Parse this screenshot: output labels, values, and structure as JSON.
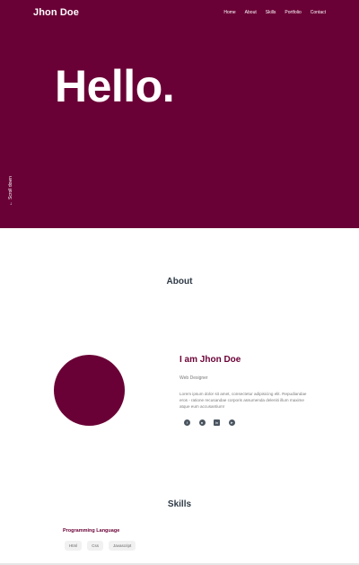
{
  "header": {
    "logo": "Jhon Doe",
    "nav": [
      "Home",
      "About",
      "Skills",
      "Portfolio",
      "Contact"
    ]
  },
  "hero": {
    "greeting": "Hello.",
    "scroll_label": "Scroll down"
  },
  "about": {
    "title": "About",
    "name_heading": "I am Jhon Doe",
    "role": "Web Designer",
    "bio": "Lorem ipsum dolor sit amet, consectetur adipisicing elit. Repudiandae eros - ratione recusandae corporis assumenda deleniti illum maxime atque eum accusantium!",
    "socials": [
      "facebook-icon",
      "github-icon",
      "linkedin-icon",
      "telegram-icon"
    ]
  },
  "skills": {
    "title": "Skills",
    "category": "Programming Language",
    "items": [
      "Html",
      "Css",
      "Javascript"
    ]
  },
  "colors": {
    "primary": "#6a0136",
    "text": "#2e3a46"
  }
}
